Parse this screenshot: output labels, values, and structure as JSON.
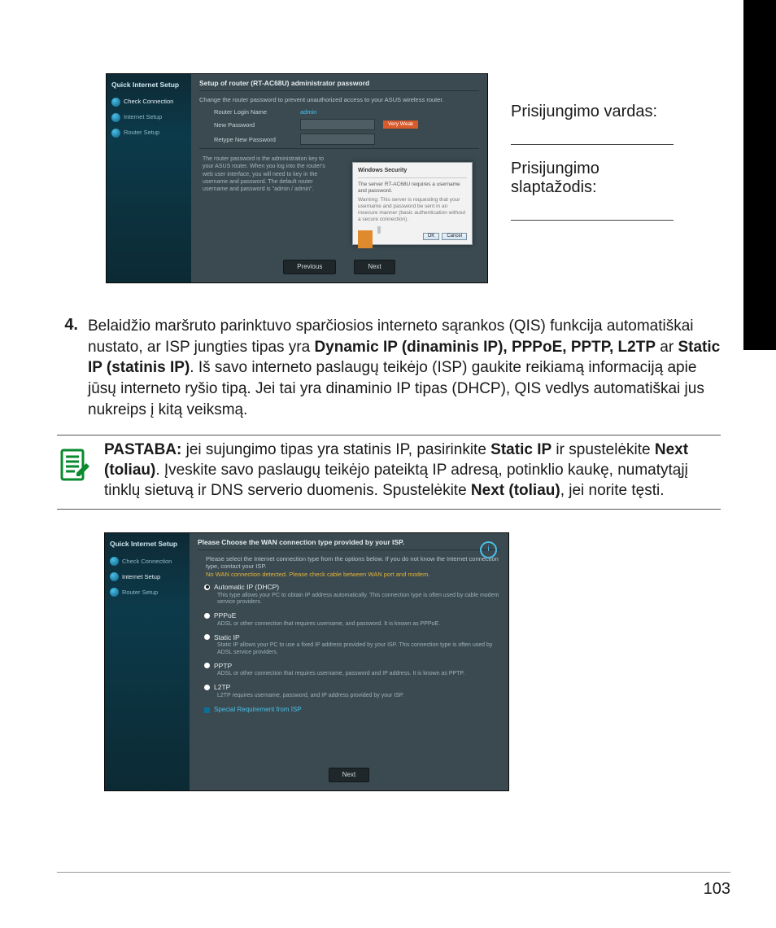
{
  "page_number": "103",
  "labels": {
    "username": "Prisijungimo vardas:",
    "password_l1": "Prisijungimo",
    "password_l2": "slaptažodis:"
  },
  "router1": {
    "sidebar_header": "Quick Internet Setup",
    "side_items": [
      "Check Connection",
      "Internet Setup",
      "Router Setup"
    ],
    "title": "Setup of router (RT-AC68U) administrator password",
    "desc": "Change the router password to prevent unauthorized access to your ASUS wireless router.",
    "row_login": "Router Login Name",
    "row_login_val": "admin",
    "row_newpw": "New Password",
    "row_newpw_badge": "Very Weak",
    "row_retype": "Retype New Password",
    "help": "The router password is the administration key to your ASUS router. When you log into the router's web user interface, you will need to key in the username and password. The default router username and password is \"admin / admin\".",
    "popup_title": "Windows Security",
    "popup_line1": "The server RT-AC68U requires a username and password.",
    "popup_line2": "Warning: This server is requesting that your username and password be sent in an insecure manner (basic authentication without a secure connection).",
    "popup_ok": "OK",
    "popup_cancel": "Cancel",
    "btn_prev": "Previous",
    "btn_next": "Next"
  },
  "step4": {
    "num": "4.",
    "p1a": "Belaidžio maršruto parinktuvo sparčiosios interneto sąrankos (QIS) funkcija automatiškai nustato, ar ISP jungties tipas yra ",
    "b1": "Dynamic IP (dinaminis IP), PPPoE, PPTP, L2TP",
    "mid": " ar ",
    "b2": "Static IP (statinis IP)",
    "p1b": ". Iš savo interneto paslaugų teikėjo (ISP) gaukite reikiamą informaciją apie jūsų interneto ryšio tipą. Jei tai yra dinaminio IP tipas (DHCP), QIS vedlys automatiškai jus nukreips į kitą veiksmą."
  },
  "note": {
    "label": "PASTABA:",
    "t1": " jei sujungimo tipas yra statinis IP, pasirinkite ",
    "b1": "Static IP",
    "t2": " ir spustelėkite ",
    "b2": "Next (toliau)",
    "t3": ". Įveskite savo paslaugų teikėjo pateiktą IP adresą, potinklio kaukę, numatytąjį tinklų sietuvą ir DNS serverio duomenis. Spustelėkite ",
    "b3": "Next (toliau)",
    "t4": ", jei norite tęsti."
  },
  "router2": {
    "sidebar_header": "Quick Internet Setup",
    "side_items": [
      "Check Connection",
      "Internet Setup",
      "Router Setup"
    ],
    "title": "Please Choose the WAN connection type provided by your ISP.",
    "desc_a": "Please select the Internet connection type from the options below. If you do not know the Internet connection type, contact your ISP.",
    "desc_b": "No WAN connection detected. Please check cable between WAN port and modem.",
    "opts": [
      {
        "label": "Automatic IP (DHCP)",
        "desc": "This type allows your PC to obtain IP address automatically. This connection type is often used by cable modem service providers.",
        "checked": true
      },
      {
        "label": "PPPoE",
        "desc": "ADSL or other connection that requires username, and password. It is known as PPPoE.",
        "checked": false
      },
      {
        "label": "Static IP",
        "desc": "Static IP allows your PC to use a fixed IP address provided by your ISP. This connection type is often used by ADSL service providers.",
        "checked": false
      },
      {
        "label": "PPTP",
        "desc": "ADSL or other connection that requires username, password and IP address. It is known as PPTP.",
        "checked": false
      },
      {
        "label": "L2TP",
        "desc": "L2TP requires username, password, and IP address provided by your ISP.",
        "checked": false
      }
    ],
    "special": "Special Requirement from ISP",
    "btn_next": "Next"
  }
}
